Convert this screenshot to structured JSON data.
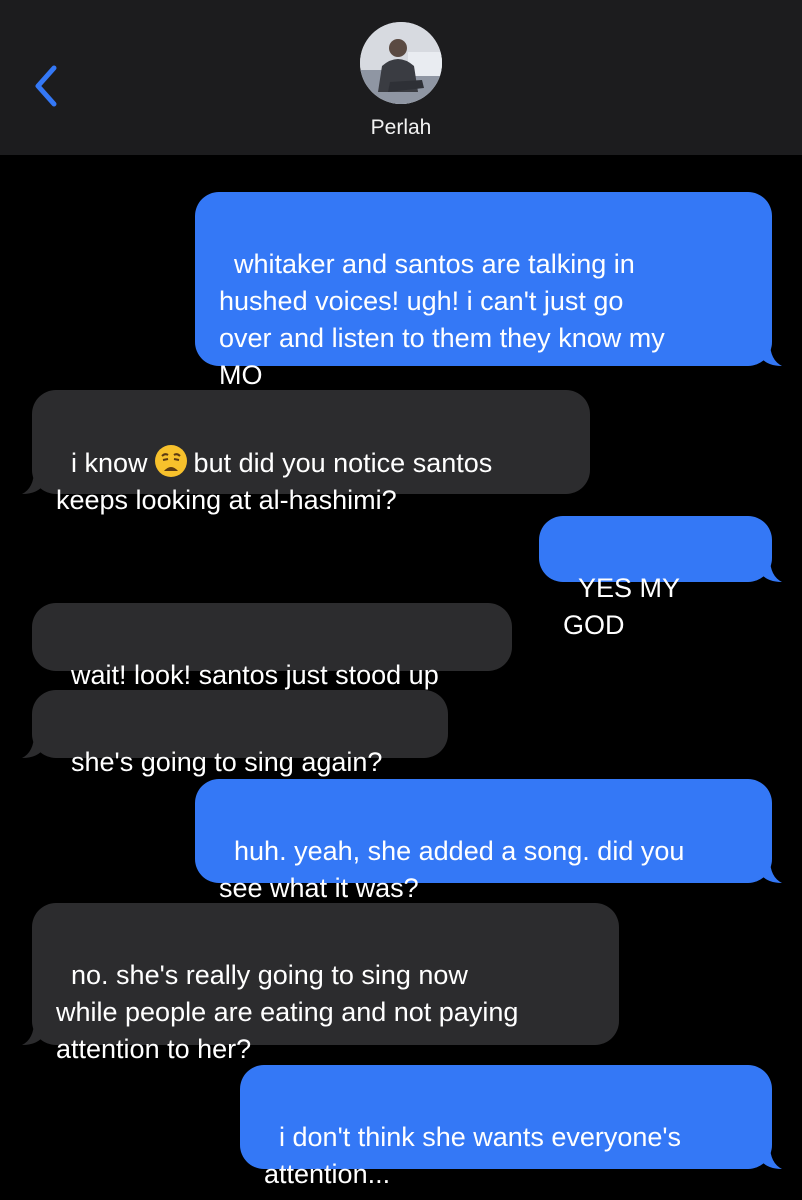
{
  "header": {
    "contact_name": "Perlah",
    "back_icon": "chevron-left-icon",
    "accent_color": "#3478f6"
  },
  "messages": [
    {
      "direction": "outgoing",
      "text": "whitaker and santos are talking in\nhushed voices! ugh! i can't just go\nover and listen to them they know my\nMO"
    },
    {
      "direction": "incoming",
      "text_before_emoji": "i know",
      "emoji": "weary-face-emoji",
      "text_after_emoji": "but did you notice santos\nkeeps looking at al-hashimi?"
    },
    {
      "direction": "outgoing",
      "text": "YES MY GOD"
    },
    {
      "direction": "incoming",
      "text": "wait! look! santos just stood up"
    },
    {
      "direction": "incoming",
      "text": "she's going to sing again?"
    },
    {
      "direction": "outgoing",
      "text": "huh. yeah, she added a song. did you\nsee what it was?"
    },
    {
      "direction": "incoming",
      "text": "no. she's really going to sing now\nwhile people are eating and not paying\nattention to her?"
    },
    {
      "direction": "outgoing",
      "text": "i don't think she wants everyone's\nattention..."
    }
  ],
  "colors": {
    "outgoing_bubble": "#3478f6",
    "incoming_bubble": "#2c2c2e",
    "background": "#000000",
    "header_background": "#1c1c1e"
  }
}
